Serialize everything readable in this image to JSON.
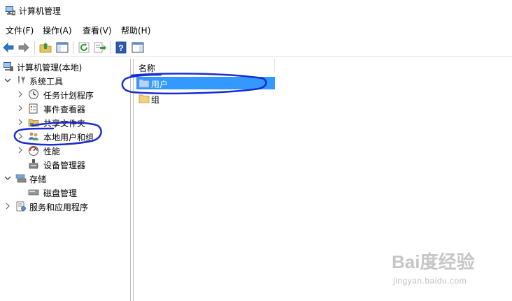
{
  "window": {
    "title": "计算机管理"
  },
  "menu": [
    {
      "label": "文件(F)"
    },
    {
      "label": "操作(A)"
    },
    {
      "label": "查看(V)"
    },
    {
      "label": "帮助(H)"
    }
  ],
  "toolbar": {
    "buttons": [
      "back-arrow-icon",
      "forward-arrow-icon",
      "up-folder-icon",
      "show-hide-tree-icon",
      "refresh-icon",
      "export-list-icon",
      "help-icon",
      "properties-pane-icon"
    ]
  },
  "tree": {
    "root": {
      "label": "计算机管理(本地)",
      "icon": "computer-management-icon"
    },
    "system_tools": {
      "label": "系统工具",
      "icon": "tools-icon"
    },
    "task_scheduler": {
      "label": "任务计划程序",
      "icon": "clock-icon"
    },
    "event_viewer": {
      "label": "事件查看器",
      "icon": "event-log-icon"
    },
    "shared_folders": {
      "label": "共享文件夹",
      "icon": "shared-folder-icon"
    },
    "local_users": {
      "label": "本地用户和组",
      "icon": "users-icon"
    },
    "performance": {
      "label": "性能",
      "icon": "performance-icon"
    },
    "device_manager": {
      "label": "设备管理器",
      "icon": "device-manager-icon"
    },
    "storage": {
      "label": "存储",
      "icon": "storage-icon"
    },
    "disk_management": {
      "label": "磁盘管理",
      "icon": "disk-icon"
    },
    "services": {
      "label": "服务和应用程序",
      "icon": "services-icon"
    }
  },
  "list": {
    "column_header": "名称",
    "rows": [
      {
        "label": "用户",
        "icon": "folder-icon",
        "selected": true
      },
      {
        "label": "组",
        "icon": "folder-icon",
        "selected": false
      }
    ]
  },
  "watermark": {
    "logo": "Bai度经验",
    "sub": "jingyan.baidu.com"
  },
  "colors": {
    "selection": "#3399ff",
    "annotation": "#1a2bd0"
  }
}
